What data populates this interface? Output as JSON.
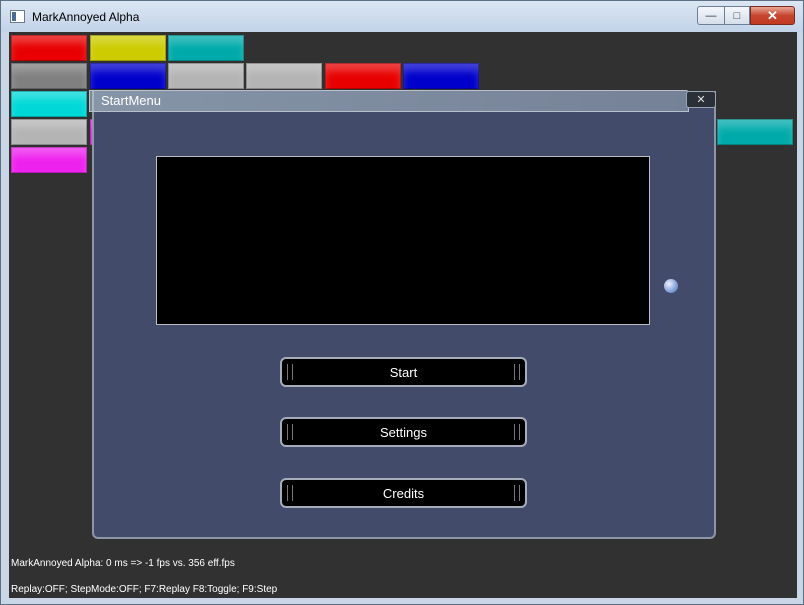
{
  "window": {
    "title": "MarkAnnoyed Alpha",
    "minimize_glyph": "—",
    "maximize_glyph": "□",
    "close_glyph": "✕"
  },
  "bricks_colors": {
    "red": "#e80000",
    "yellow": "#cccc00",
    "teal": "#00aaaa",
    "gray": "#808080",
    "blue": "#0000cc",
    "silver": "#b4b4b4",
    "cyan": "#00d8d8",
    "magenta": "#ee22ee",
    "slate": "#6b6f8f",
    "white": "#e8e8f0",
    "lightcyan": "#20e8f0",
    "sky": "#20c8e0",
    "lavender": "#a0a4c8"
  },
  "dialog": {
    "title": "StartMenu",
    "close_glyph": "✕",
    "buttons": {
      "start": "Start",
      "settings": "Settings",
      "credits": "Credits"
    }
  },
  "status": {
    "line1": "MarkAnnoyed Alpha: 0 ms => -1 fps vs. 356 eff.fps",
    "line2": "Replay:OFF; StepMode:OFF; F7:Replay F8:Toggle; F9:Step"
  }
}
